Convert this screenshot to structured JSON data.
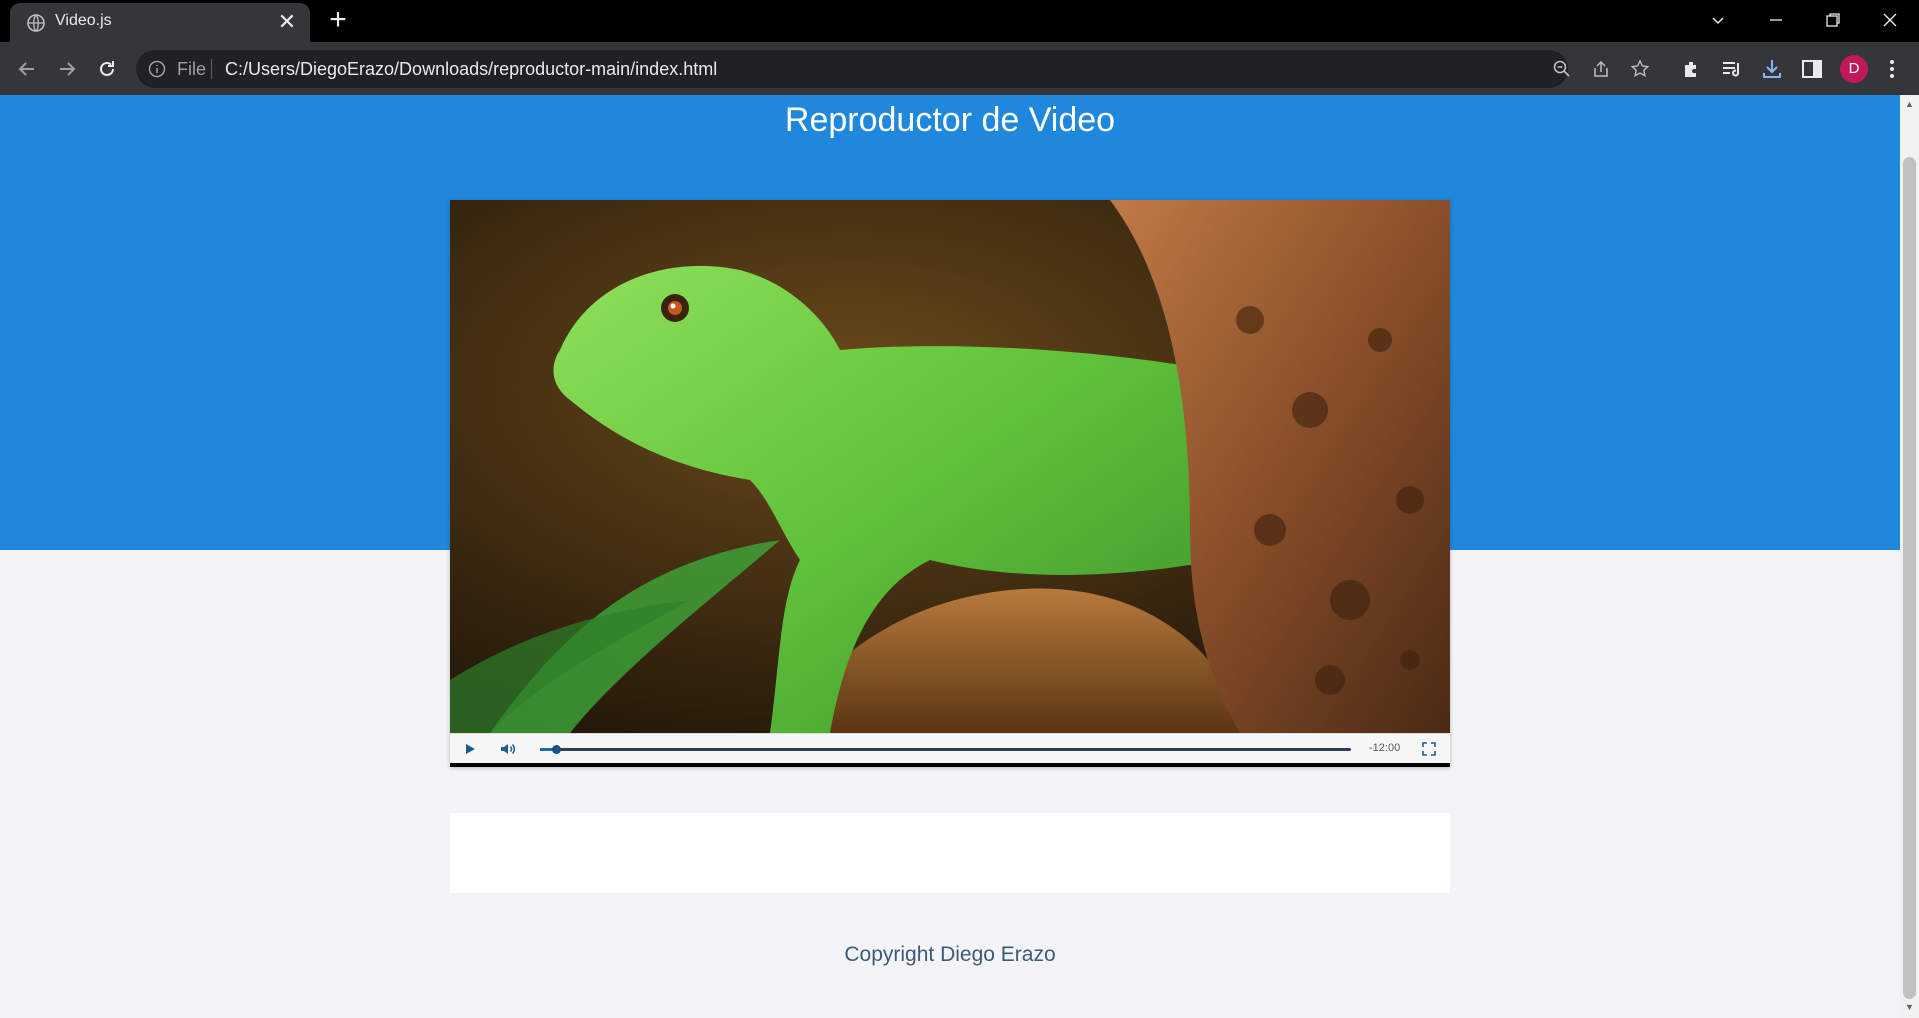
{
  "browser": {
    "tab_title": "Video.js",
    "tab_close": "✕",
    "new_tab": "+",
    "scheme_label": "File",
    "url": "C:/Users/DiegoErazo/Downloads/reproductor-main/index.html",
    "profile_initial": "D",
    "icons": [
      "globe-icon",
      "back-icon",
      "forward-icon",
      "reload-icon",
      "info-icon",
      "zoom-icon",
      "share-icon",
      "bookmark-star-icon",
      "extensions-icon",
      "media-queue-icon",
      "download-icon",
      "side-panel-icon",
      "menu-icon"
    ],
    "window_controls": {
      "dropdown": "⌄",
      "minimize": "—",
      "restore": "❐",
      "close": "✕"
    },
    "profile_color": "#c2185b"
  },
  "page": {
    "title": "Reproductor de Video",
    "hero_color": "#1f88dc",
    "footer": "Copyright Diego Erazo"
  },
  "player": {
    "poster_subject": "green lizard",
    "remaining_time": "-12:00",
    "progress_fraction": 0.02,
    "controls": [
      "play-icon",
      "volume-icon",
      "fullscreen-icon"
    ]
  }
}
